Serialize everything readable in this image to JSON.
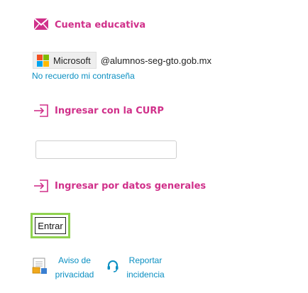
{
  "sections": {
    "educational": {
      "label": "Cuenta educativa",
      "icon": "envelope-icon"
    },
    "curp": {
      "label": "Ingresar con la CURP",
      "icon": "login-arrow-icon"
    },
    "general": {
      "label": "Ingresar por datos generales",
      "icon": "login-arrow-icon"
    }
  },
  "microsoft": {
    "button_label": "Microsoft",
    "domain": "@alumnos-seg-gto.gob.mx",
    "logo_colors": [
      "#f25022",
      "#7fba00",
      "#00a4ef",
      "#ffb900"
    ]
  },
  "forgot_password": "No recuerdo mi contraseña",
  "curp_input": {
    "value": "",
    "placeholder": ""
  },
  "submit_label": "Entrar",
  "footer": {
    "privacy_line1": "Aviso de",
    "privacy_line2": "privacidad",
    "support_line1": "Reportar",
    "support_line2": "incidencia"
  },
  "colors": {
    "accent": "#d0308a",
    "link": "#0a8fc2",
    "focus_ring": "#8fd14f"
  }
}
